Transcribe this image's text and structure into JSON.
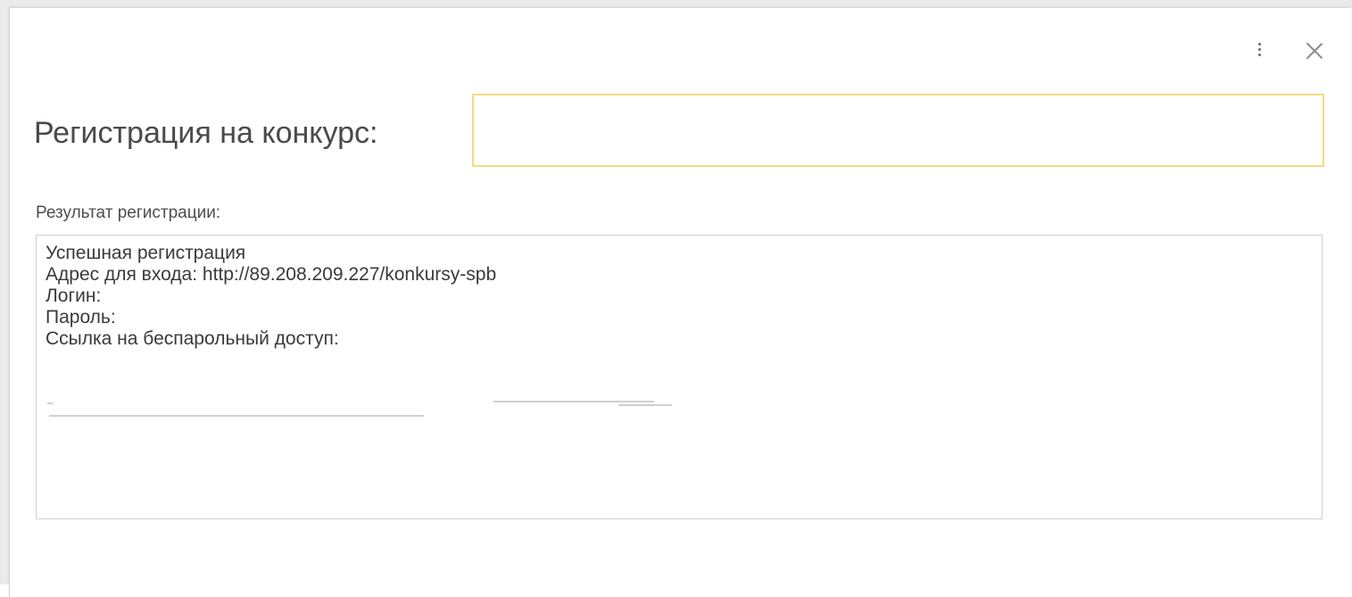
{
  "window": {
    "menu_icon": "more-vertical-icon",
    "close_icon": "close-icon"
  },
  "registration": {
    "label": "Регистрация на конкурс:",
    "input_value": "",
    "input_accent_color": "#f0dc82"
  },
  "result": {
    "label": "Результат регистрации:",
    "lines": [
      "Успешная регистрация",
      "Адрес для входа: http://89.208.209.227/konkursy-spb",
      "Логин:",
      "Пароль:",
      "Ссылка на беспарольный доступ: "
    ]
  }
}
